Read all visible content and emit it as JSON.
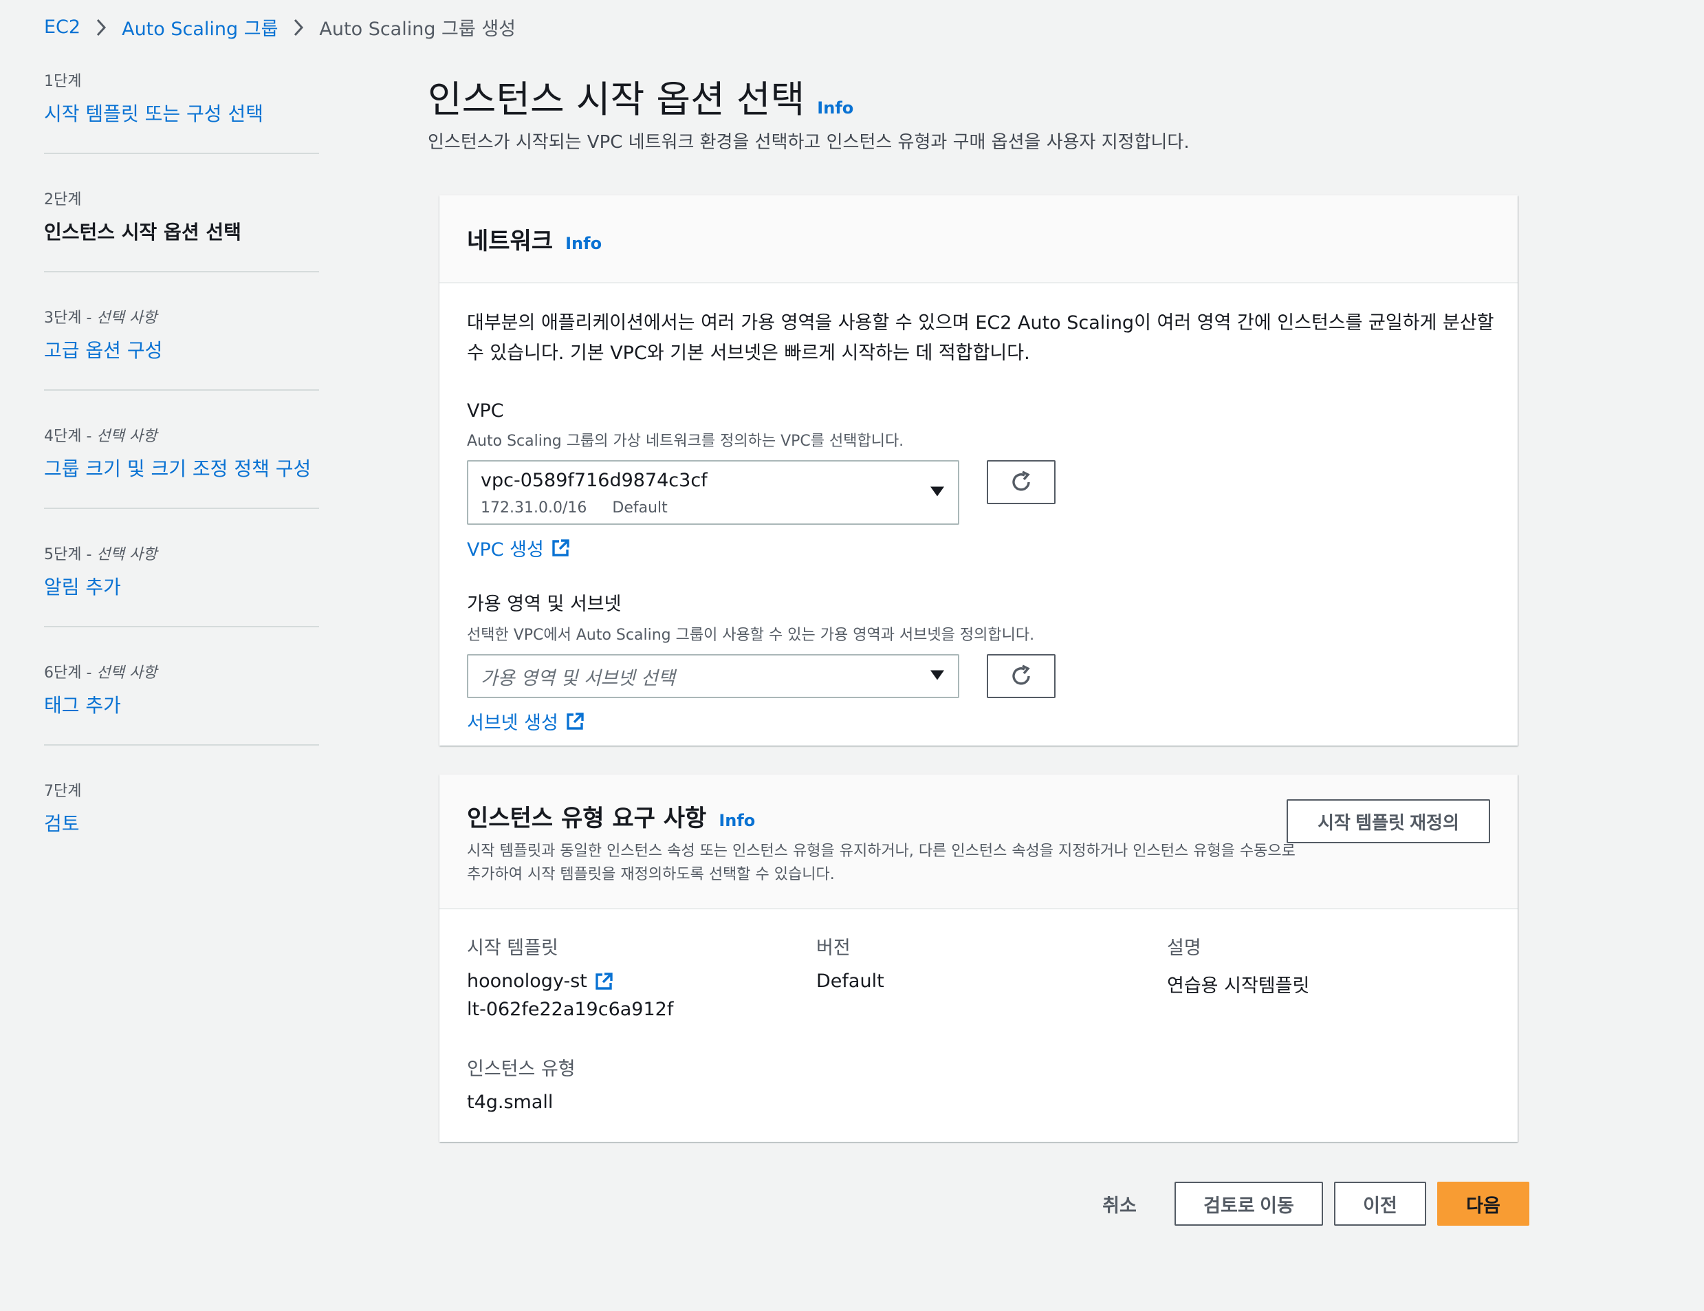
{
  "breadcrumb": {
    "items": [
      "EC2",
      "Auto Scaling 그룹"
    ],
    "current": "Auto Scaling 그룹 생성"
  },
  "steps": [
    {
      "num": "1단계",
      "optional": "",
      "label": "시작 템플릿 또는 구성 선택"
    },
    {
      "num": "2단계",
      "optional": "",
      "label": "인스턴스 시작 옵션 선택"
    },
    {
      "num": "3단계 - ",
      "optional": "선택 사항",
      "label": "고급 옵션 구성"
    },
    {
      "num": "4단계 - ",
      "optional": "선택 사항",
      "label": "그룹 크기 및 크기 조정 정책 구성"
    },
    {
      "num": "5단계 - ",
      "optional": "선택 사항",
      "label": "알림 추가"
    },
    {
      "num": "6단계 - ",
      "optional": "선택 사항",
      "label": "태그 추가"
    },
    {
      "num": "7단계",
      "optional": "",
      "label": "검토"
    }
  ],
  "page": {
    "title": "인스턴스 시작 옵션 선택",
    "info": "Info",
    "description": "인스턴스가 시작되는 VPC 네트워크 환경을 선택하고 인스턴스 유형과 구매 옵션을 사용자 지정합니다."
  },
  "network": {
    "title": "네트워크",
    "info": "Info",
    "description": "대부분의 애플리케이션에서는 여러 가용 영역을 사용할 수 있으며 EC2 Auto Scaling이 여러 영역 간에 인스턴스를 균일하게 분산할 수 있습니다. 기본 VPC와 기본 서브넷은 빠르게 시작하는 데 적합합니다.",
    "vpc_label": "VPC",
    "vpc_desc": "Auto Scaling 그룹의 가상 네트워크를 정의하는 VPC를 선택합니다.",
    "vpc_value": "vpc-0589f716d9874c3cf",
    "vpc_cidr": "172.31.0.0/16",
    "vpc_tag": "Default",
    "vpc_create": "VPC 생성",
    "az_label": "가용 영역 및 서브넷",
    "az_desc": "선택한 VPC에서 Auto Scaling 그룹이 사용할 수 있는 가용 영역과 서브넷을 정의합니다.",
    "az_placeholder": "가용 영역 및 서브넷 선택",
    "subnet_create": "서브넷 생성"
  },
  "instance_req": {
    "title": "인스턴스 유형 요구 사항",
    "info": "Info",
    "description": "시작 템플릿과 동일한 인스턴스 속성 또는 인스턴스 유형을 유지하거나, 다른 인스턴스 속성을 지정하거나 인스턴스 유형을 수동으로 추가하여 시작 템플릿을 재정의하도록 선택할 수 있습니다.",
    "override_button": "시작 템플릿 재정의",
    "template_label": "시작 템플릿",
    "template_name": "hoonology-st",
    "template_id": "lt-062fe22a19c6a912f",
    "version_label": "버전",
    "version_value": "Default",
    "desc_label": "설명",
    "desc_value": "연습용 시작템플릿",
    "type_label": "인스턴스 유형",
    "type_value": "t4g.small"
  },
  "footer": {
    "cancel": "취소",
    "review": "검토로 이동",
    "previous": "이전",
    "next": "다음"
  },
  "colors": {
    "link": "#0972d3",
    "primary_button": "#f89c33",
    "background": "#f2f3f3"
  }
}
